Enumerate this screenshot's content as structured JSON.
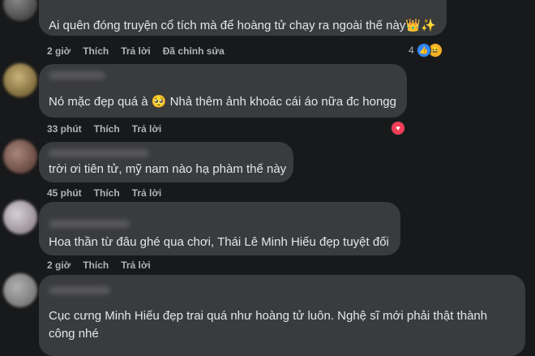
{
  "comments": [
    {
      "text": "Ai quên đóng truyện cổ tích mà để hoàng tử chạy ra ngoài thế này👑✨",
      "time": "2 giờ",
      "like": "Thích",
      "reply": "Trả lời",
      "edited": "Đã chỉnh sửa",
      "reaction_count": "4",
      "reactions": [
        "like-icon",
        "haha-icon"
      ]
    },
    {
      "text": "Nó mặc đẹp quá à 🥺 Nhả thêm ảnh khoác cái áo nữa đc hongg",
      "time": "33 phút",
      "like": "Thích",
      "reply": "Trả lời",
      "reactions": [
        "heart-icon"
      ]
    },
    {
      "text": "trời ơi tiên tử, mỹ nam nào hạ phàm thế này",
      "time": "45 phút",
      "like": "Thích",
      "reply": "Trả lời"
    },
    {
      "text": "Hoa thần từ đâu ghé qua chơi, Thái Lê Minh Hiếu đẹp tuyệt đối",
      "time": "2 giờ",
      "like": "Thích",
      "reply": "Trả lời"
    },
    {
      "text_line1": "Cục cưng Minh Hiếu đẹp trai quá như hoàng tử luôn. Nghệ sĩ mới phải thật thành",
      "text_line2": "công nhé"
    }
  ],
  "colors": {
    "background": "#18191a",
    "bubble": "#3a3b3c",
    "meta": "#b0b3b8",
    "like_blue": "#2d88ff",
    "heart_red": "#f33e58"
  }
}
